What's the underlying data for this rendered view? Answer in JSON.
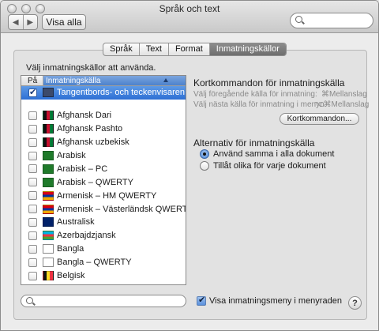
{
  "window": {
    "title": "Språk och text"
  },
  "toolbar": {
    "back_glyph": "◀",
    "forward_glyph": "▶",
    "show_all_label": "Visa alla",
    "search_placeholder": ""
  },
  "tabs": [
    {
      "label": "Språk",
      "active": false
    },
    {
      "label": "Text",
      "active": false
    },
    {
      "label": "Format",
      "active": false
    },
    {
      "label": "Inmatningskällor",
      "active": true
    }
  ],
  "instruction": "Välj inmatningskällor att använda.",
  "list": {
    "columns": {
      "on": "På",
      "name": "Inmatningskälla"
    },
    "selected": {
      "label": "Tangentbords- och teckenvisaren",
      "checked": true,
      "icon": "keyboard-viewer-icon"
    },
    "items": [
      {
        "label": "Afghansk Dari",
        "checked": false,
        "icon": "flag-afghanistan-icon"
      },
      {
        "label": "Afghansk Pashto",
        "checked": false,
        "icon": "flag-afghanistan-icon"
      },
      {
        "label": "Afghansk uzbekisk",
        "checked": false,
        "icon": "flag-afghanistan-icon"
      },
      {
        "label": "Arabisk",
        "checked": false,
        "icon": "crescent-icon"
      },
      {
        "label": "Arabisk – PC",
        "checked": false,
        "icon": "crescent-icon"
      },
      {
        "label": "Arabisk – QWERTY",
        "checked": false,
        "icon": "crescent-icon"
      },
      {
        "label": "Armenisk – HM QWERTY",
        "checked": false,
        "icon": "flag-armenia-icon"
      },
      {
        "label": "Armenisk – Västerländsk QWERTY",
        "checked": false,
        "icon": "flag-armenia-icon"
      },
      {
        "label": "Australisk",
        "checked": false,
        "icon": "flag-australia-icon"
      },
      {
        "label": "Azerbajdzjansk",
        "checked": false,
        "icon": "flag-azerbaijan-icon"
      },
      {
        "label": "Bangla",
        "checked": false,
        "icon": "bangla-script-icon"
      },
      {
        "label": "Bangla – QWERTY",
        "checked": false,
        "icon": "bangla-script-icon"
      },
      {
        "label": "Belgisk",
        "checked": false,
        "icon": "flag-belgium-icon"
      }
    ],
    "filter_placeholder": ""
  },
  "shortcuts": {
    "heading": "Kortkommandon för inmatningskälla",
    "prev_label": "Välj föregående källa för inmatning:",
    "prev_value": "⌘Mellanslag",
    "next_label": "Välj nästa källa för inmatning i menyn:",
    "next_value": "⌥⌘Mellanslag",
    "button_label": "Kortkommandon..."
  },
  "options": {
    "heading": "Alternativ för inmatningskälla",
    "radio_same": "Använd samma i alla dokument",
    "radio_per_doc": "Tillåt olika för varje dokument",
    "selected": "radio_same"
  },
  "menubar_checkbox": {
    "label": "Visa inmatningsmeny i menyraden",
    "checked": true
  },
  "help_label": "?",
  "colors": {
    "selection": "#2d6fd4",
    "tab_active": "#6e6e6e"
  }
}
